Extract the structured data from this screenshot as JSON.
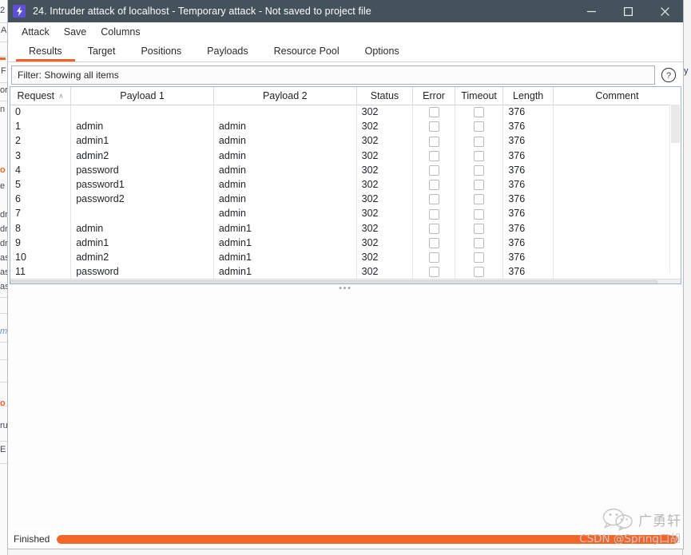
{
  "window": {
    "title": "24. Intruder attack of localhost - Temporary attack - Not saved to project file",
    "app_icon": "lightning-bolt-icon",
    "titlebar_color": "#44525c",
    "controls": {
      "minimize": "minimize-icon",
      "maximize": "maximize-icon",
      "close": "close-icon"
    }
  },
  "menubar": {
    "items": [
      {
        "label": "Attack"
      },
      {
        "label": "Save"
      },
      {
        "label": "Columns"
      }
    ]
  },
  "tabs": {
    "active": "Results",
    "accent_color": "#f26227",
    "items": [
      {
        "label": "Results"
      },
      {
        "label": "Target"
      },
      {
        "label": "Positions"
      },
      {
        "label": "Payloads"
      },
      {
        "label": "Resource Pool"
      },
      {
        "label": "Options"
      }
    ]
  },
  "filter": {
    "value": "Filter: Showing all items",
    "help_icon": "question-mark-circle-icon"
  },
  "table": {
    "columns": [
      {
        "key": "request",
        "label": "Request",
        "sort": "asc",
        "sort_caret": "∧"
      },
      {
        "key": "payload1",
        "label": "Payload 1"
      },
      {
        "key": "payload2",
        "label": "Payload 2"
      },
      {
        "key": "status",
        "label": "Status"
      },
      {
        "key": "error",
        "label": "Error"
      },
      {
        "key": "timeout",
        "label": "Timeout"
      },
      {
        "key": "length",
        "label": "Length"
      },
      {
        "key": "comment",
        "label": "Comment"
      }
    ],
    "rows": [
      {
        "request": "0",
        "payload1": "",
        "payload2": "",
        "status": "302",
        "error": false,
        "timeout": false,
        "length": "376",
        "comment": ""
      },
      {
        "request": "1",
        "payload1": "admin",
        "payload2": "admin",
        "status": "302",
        "error": false,
        "timeout": false,
        "length": "376",
        "comment": ""
      },
      {
        "request": "2",
        "payload1": "admin1",
        "payload2": "admin",
        "status": "302",
        "error": false,
        "timeout": false,
        "length": "376",
        "comment": ""
      },
      {
        "request": "3",
        "payload1": "admin2",
        "payload2": "admin",
        "status": "302",
        "error": false,
        "timeout": false,
        "length": "376",
        "comment": ""
      },
      {
        "request": "4",
        "payload1": "password",
        "payload2": "admin",
        "status": "302",
        "error": false,
        "timeout": false,
        "length": "376",
        "comment": ""
      },
      {
        "request": "5",
        "payload1": "password1",
        "payload2": "admin",
        "status": "302",
        "error": false,
        "timeout": false,
        "length": "376",
        "comment": ""
      },
      {
        "request": "6",
        "payload1": "password2",
        "payload2": "admin",
        "status": "302",
        "error": false,
        "timeout": false,
        "length": "376",
        "comment": ""
      },
      {
        "request": "7",
        "payload1": "",
        "payload2": "admin",
        "status": "302",
        "error": false,
        "timeout": false,
        "length": "376",
        "comment": ""
      },
      {
        "request": "8",
        "payload1": "admin",
        "payload2": "admin1",
        "status": "302",
        "error": false,
        "timeout": false,
        "length": "376",
        "comment": ""
      },
      {
        "request": "9",
        "payload1": "admin1",
        "payload2": "admin1",
        "status": "302",
        "error": false,
        "timeout": false,
        "length": "376",
        "comment": ""
      },
      {
        "request": "10",
        "payload1": "admin2",
        "payload2": "admin1",
        "status": "302",
        "error": false,
        "timeout": false,
        "length": "376",
        "comment": ""
      },
      {
        "request": "11",
        "payload1": "password",
        "payload2": "admin1",
        "status": "302",
        "error": false,
        "timeout": false,
        "length": "376",
        "comment": ""
      }
    ]
  },
  "splitter": {
    "handle": "•••"
  },
  "status": {
    "text": "Finished",
    "progress_percent": 100,
    "progress_color": "#f2662a"
  },
  "watermark": {
    "icon": "wechat-icon",
    "name": "广勇轩",
    "credit": "CSDN @Spring口胡"
  },
  "background_fragments": {
    "left": [
      "2",
      "A",
      "F",
      "or",
      "n",
      "o",
      "e",
      "dr",
      "dr",
      "dr",
      "as",
      "as",
      "as",
      "m",
      "o",
      "ru",
      "E"
    ],
    "right": [
      "y"
    ]
  }
}
